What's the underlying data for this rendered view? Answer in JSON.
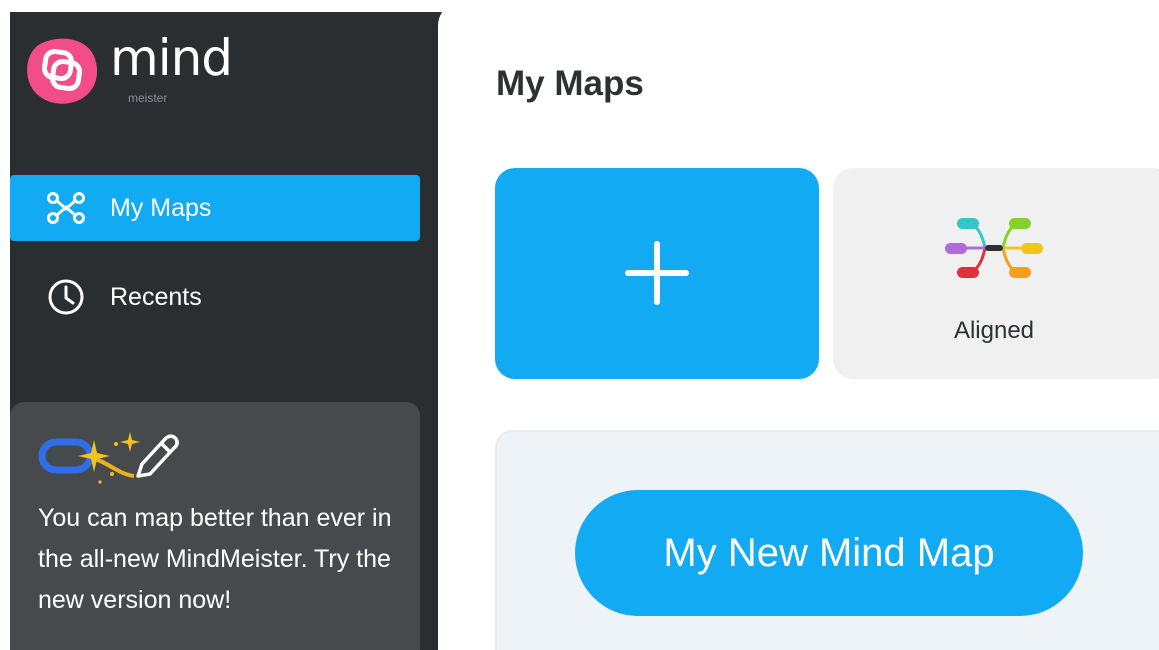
{
  "brand": {
    "name": "mind",
    "sub": "meister",
    "logo_icon": "mindmeister-logo-icon",
    "logo_color": "#f24d88"
  },
  "sidebar": {
    "items": [
      {
        "label": "My Maps",
        "icon": "mind-map-icon",
        "active": true
      },
      {
        "label": "Recents",
        "icon": "clock-icon",
        "active": false
      }
    ],
    "promo": {
      "text": "You can map better than ever in the all-new MindMeister. Try the new version now!",
      "icon": "magic-wand-pencil-icon"
    }
  },
  "main": {
    "title": "My Maps",
    "new_card_icon": "plus-icon",
    "template": {
      "label": "Aligned",
      "icon": "aligned-mind-map-template-icon"
    },
    "map": {
      "name": "My New Mind Map"
    }
  },
  "colors": {
    "sidebar_bg": "#2b2e31",
    "accent": "#12aaf2",
    "promo_bg": "#474a4d",
    "card_bg": "#f0f0f0"
  }
}
